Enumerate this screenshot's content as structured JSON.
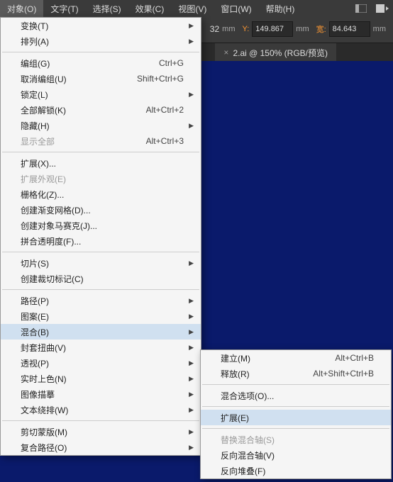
{
  "menubar": {
    "items": [
      "对象(O)",
      "文字(T)",
      "选择(S)",
      "效果(C)",
      "视图(V)",
      "窗口(W)",
      "帮助(H)"
    ]
  },
  "toolbar": {
    "y_label": "Y:",
    "y_value": "149.867",
    "y_unit": "mm",
    "w_label": "宽:",
    "w_value": "84.643",
    "w_unit": "mm",
    "hidden_value": "32",
    "hidden_unit": "mm"
  },
  "tab": {
    "title": "2.ai @ 150% (RGB/预览)",
    "close": "×"
  },
  "menu": [
    {
      "label": "变换(T)",
      "sub": true
    },
    {
      "label": "排列(A)",
      "sub": true
    },
    {
      "sep": true
    },
    {
      "label": "编组(G)",
      "shortcut": "Ctrl+G"
    },
    {
      "label": "取消编组(U)",
      "shortcut": "Shift+Ctrl+G"
    },
    {
      "label": "锁定(L)",
      "sub": true
    },
    {
      "label": "全部解锁(K)",
      "shortcut": "Alt+Ctrl+2"
    },
    {
      "label": "隐藏(H)",
      "sub": true
    },
    {
      "label": "显示全部",
      "shortcut": "Alt+Ctrl+3",
      "disabled": true
    },
    {
      "sep": true
    },
    {
      "label": "扩展(X)..."
    },
    {
      "label": "扩展外观(E)",
      "disabled": true
    },
    {
      "label": "栅格化(Z)..."
    },
    {
      "label": "创建渐变网格(D)..."
    },
    {
      "label": "创建对象马赛克(J)..."
    },
    {
      "label": "拼合透明度(F)..."
    },
    {
      "sep": true
    },
    {
      "label": "切片(S)",
      "sub": true
    },
    {
      "label": "创建裁切标记(C)"
    },
    {
      "sep": true
    },
    {
      "label": "路径(P)",
      "sub": true
    },
    {
      "label": "图案(E)",
      "sub": true
    },
    {
      "label": "混合(B)",
      "sub": true,
      "highlighted": true
    },
    {
      "label": "封套扭曲(V)",
      "sub": true
    },
    {
      "label": "透视(P)",
      "sub": true
    },
    {
      "label": "实时上色(N)",
      "sub": true
    },
    {
      "label": "图像描摹",
      "sub": true
    },
    {
      "label": "文本绕排(W)",
      "sub": true
    },
    {
      "sep": true
    },
    {
      "label": "剪切蒙版(M)",
      "sub": true
    },
    {
      "label": "复合路径(O)",
      "sub": true
    }
  ],
  "submenu": [
    {
      "label": "建立(M)",
      "shortcut": "Alt+Ctrl+B"
    },
    {
      "label": "释放(R)",
      "shortcut": "Alt+Shift+Ctrl+B"
    },
    {
      "sep": true
    },
    {
      "label": "混合选项(O)..."
    },
    {
      "sep": true
    },
    {
      "label": "扩展(E)",
      "highlighted": true
    },
    {
      "sep": true
    },
    {
      "label": "替换混合轴(S)",
      "disabled": true
    },
    {
      "label": "反向混合轴(V)"
    },
    {
      "label": "反向堆叠(F)"
    }
  ]
}
